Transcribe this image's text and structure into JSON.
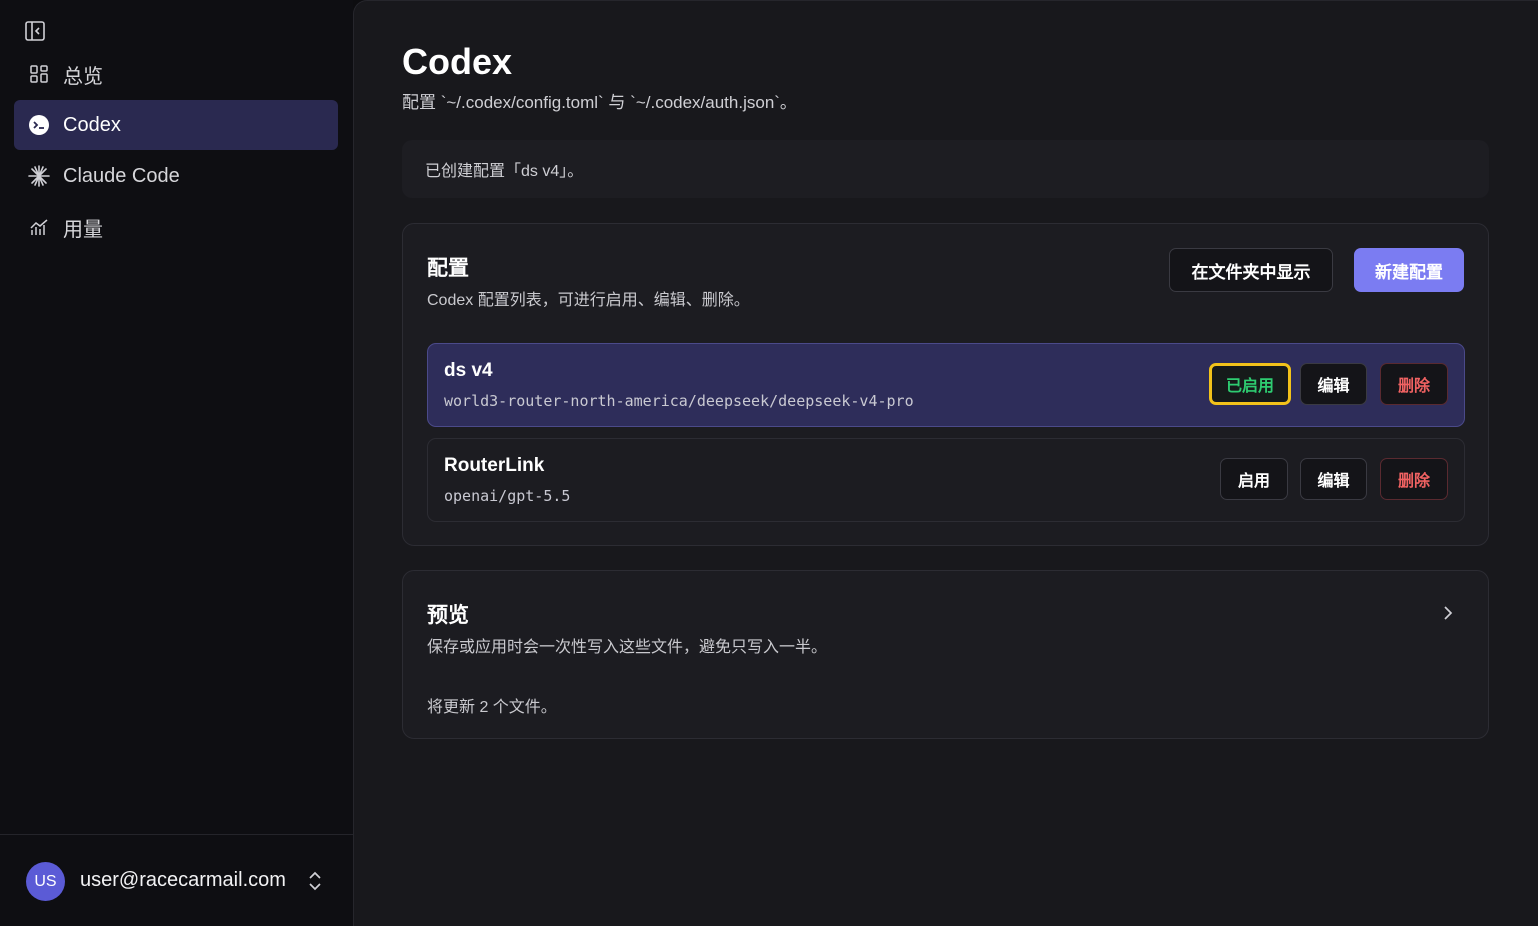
{
  "sidebar": {
    "items": [
      {
        "label": "总览",
        "icon": "dashboard-icon"
      },
      {
        "label": "Codex",
        "icon": "codex-icon",
        "active": true
      },
      {
        "label": "Claude Code",
        "icon": "claude-icon"
      },
      {
        "label": "用量",
        "icon": "chart-icon"
      }
    ],
    "user": {
      "initials": "US",
      "email": "user@racecarmail.com"
    }
  },
  "main": {
    "title": "Codex",
    "subtitle": "配置 `~/.codex/config.toml` 与 `~/.codex/auth.json`。",
    "notice": "已创建配置「ds v4」。",
    "config_card": {
      "title": "配置",
      "description": "Codex 配置列表，可进行启用、编辑、删除。",
      "show_in_folder_label": "在文件夹中显示",
      "new_config_label": "新建配置",
      "rows": [
        {
          "name": "ds v4",
          "model": "world3-router-north-america/deepseek/deepseek-v4-pro",
          "status_label": "已启用",
          "edit_label": "编辑",
          "delete_label": "删除",
          "active": true
        },
        {
          "name": "RouterLink",
          "model": "openai/gpt-5.5",
          "status_label": "启用",
          "edit_label": "编辑",
          "delete_label": "删除",
          "active": false
        }
      ]
    },
    "preview_card": {
      "title": "预览",
      "description": "保存或应用时会一次性写入这些文件，避免只写入一半。",
      "info": "将更新 2 个文件。"
    }
  },
  "colors": {
    "accent": "#7b7cf2",
    "active_row": "#2e2d5a",
    "enabled_text": "#2ecc71",
    "enabled_highlight": "#f2c21a",
    "danger": "#f06262"
  }
}
